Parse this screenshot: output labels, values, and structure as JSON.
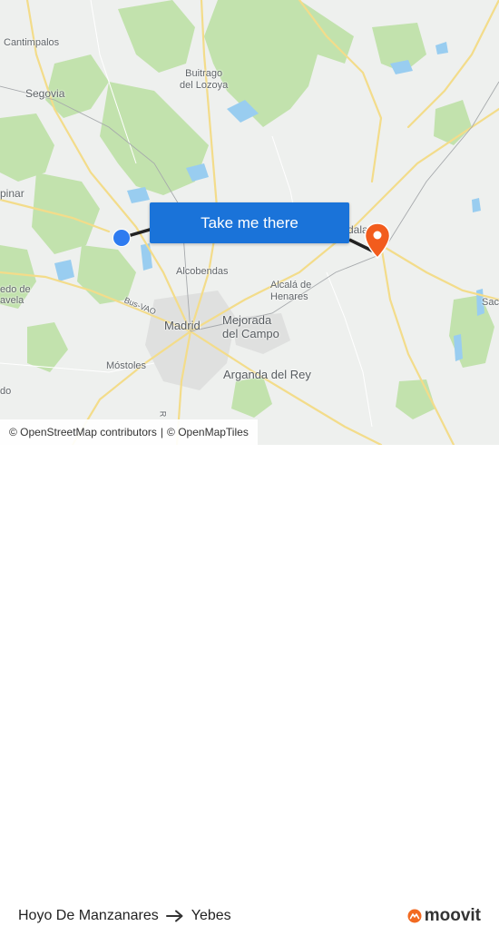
{
  "map": {
    "labels": {
      "cantimpalos": "Cantimpalos",
      "segovia": "Segovia",
      "buitrago": "Buitrago\ndel Lozoya",
      "espinar": "pinar",
      "alcobendas": "Alcobendas",
      "alcala": "Alcalá de\nHenares",
      "madrid": "Madrid",
      "mejorada": "Mejorada\ndel Campo",
      "mostoles": "Móstoles",
      "arganda": "Arganda del Rey",
      "guadalajara": "dala",
      "busvao": "Bus-VAO",
      "navalcarnero_frag": "edo de\navela",
      "sace": "Sace",
      "left_frag": "do",
      "road_frag": "R"
    },
    "colors": {
      "land": "#eef0ee",
      "forest": "#b9dca4",
      "water": "#8fc7ee",
      "road": "#f6e39a",
      "route_line": "#222222",
      "origin": "#2e7bf0",
      "destination_pin": "#f25c1d"
    },
    "cta_label": "Take me there",
    "origin_icon": "origin-location-icon",
    "destination_icon": "destination-pin-icon"
  },
  "attribution": {
    "osm": "© OpenStreetMap contributors",
    "separator": "|",
    "omt": "© OpenMapTiles"
  },
  "route": {
    "from": "Hoyo De Manzanares",
    "to": "Yebes",
    "arrow_icon": "arrow-right-icon"
  },
  "brand": {
    "name": "moovit",
    "icon": "moovit-logo-icon",
    "color": "#f26a21"
  }
}
